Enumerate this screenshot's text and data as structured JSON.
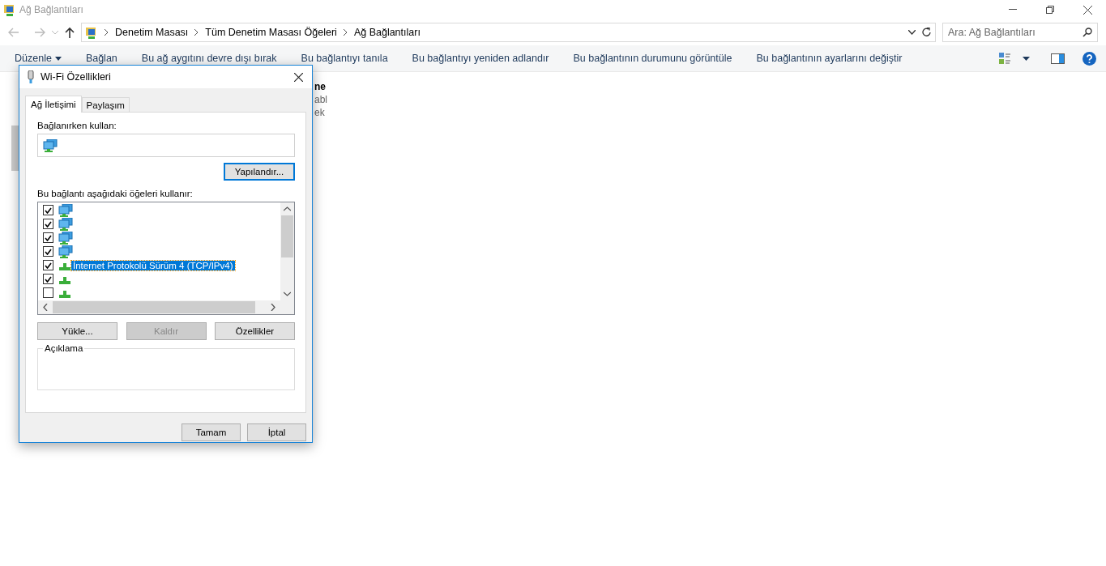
{
  "window": {
    "title": "Ağ Bağlantıları"
  },
  "breadcrumb": [
    "Denetim Masası",
    "Tüm Denetim Masası Öğeleri",
    "Ağ Bağlantıları"
  ],
  "search": {
    "placeholder": "Ara: Ağ Bağlantıları"
  },
  "toolbar": [
    {
      "label": "Düzenle",
      "dropdown": true
    },
    {
      "label": "Bağlan",
      "dropdown": false
    },
    {
      "label": "Bu ağ aygıtını devre dışı bırak",
      "dropdown": false
    },
    {
      "label": "Bu bağlantıyı tanıla",
      "dropdown": false
    },
    {
      "label": "Bu bağlantıyı yeniden adlandır",
      "dropdown": false
    },
    {
      "label": "Bu bağlantının durumunu görüntüle",
      "dropdown": false
    },
    {
      "label": "Bu bağlantının ayarlarını değiştir",
      "dropdown": false
    }
  ],
  "content_fragments": [
    "ne",
    "abl",
    "ek"
  ],
  "dialog": {
    "title": "Wi-Fi Özellikleri",
    "tabs": [
      {
        "label": "Ağ İletişimi",
        "selected": true
      },
      {
        "label": "Paylaşım",
        "selected": false
      }
    ],
    "connect_using_label": "Bağlanırken kullan:",
    "configure_button": "Yapılandır...",
    "items_label": "Bu bağlantı aşağıdaki öğeleri kullanır:",
    "items": [
      {
        "kind": "monitor",
        "checked": true,
        "selected": false
      },
      {
        "kind": "monitor",
        "checked": true,
        "selected": false
      },
      {
        "kind": "monitor",
        "checked": true,
        "selected": false
      },
      {
        "kind": "monitor",
        "checked": true,
        "selected": false
      },
      {
        "kind": "protocol",
        "checked": true,
        "selected": true,
        "label": "İnternet Protokolü Sürüm 4 (TCP/IPv4)"
      },
      {
        "kind": "protocol",
        "checked": true,
        "selected": false
      },
      {
        "kind": "protocol",
        "checked": false,
        "selected": false
      }
    ],
    "item_buttons": [
      {
        "label": "Yükle...",
        "disabled": false
      },
      {
        "label": "Kaldır",
        "disabled": true
      },
      {
        "label": "Özellikler",
        "disabled": false
      }
    ],
    "description_label": "Açıklama",
    "footer_buttons": [
      "Tamam",
      "İptal"
    ]
  }
}
